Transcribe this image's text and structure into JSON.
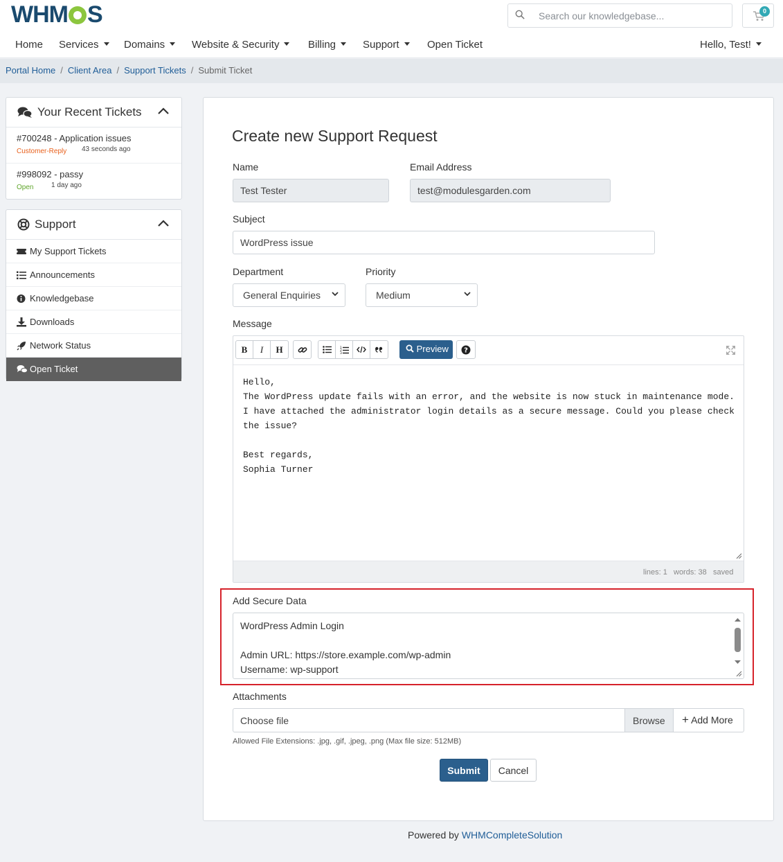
{
  "brand": {
    "logo_text_a": "WHM",
    "logo_text_b": "S",
    "colors": {
      "primary": "#2b5f8d",
      "accent": "#8cc63e",
      "highlight": "#d6222a"
    }
  },
  "search": {
    "placeholder": "Search our knowledgebase..."
  },
  "cart": {
    "count": "0"
  },
  "nav": {
    "home": "Home",
    "services": "Services",
    "domains": "Domains",
    "website_security": "Website & Security",
    "billing": "Billing",
    "support": "Support",
    "open_ticket": "Open Ticket",
    "user": "Hello, Test!"
  },
  "breadcrumb": {
    "portal_home": "Portal Home",
    "client_area": "Client Area",
    "support_tickets": "Support Tickets",
    "current": "Submit Ticket"
  },
  "recent_tickets": {
    "title": "Your Recent Tickets",
    "items": [
      {
        "title": "#700248 - Application issues",
        "status": "Customer-Reply",
        "status_color": "#e8601c",
        "ago": "43 seconds ago"
      },
      {
        "title": "#998092 - passy",
        "status": "Open",
        "status_color": "#5fa52a",
        "ago": "1 day ago"
      }
    ]
  },
  "support_panel": {
    "title": "Support",
    "items": [
      {
        "label": "My Support Tickets",
        "icon": "ticket-icon"
      },
      {
        "label": "Announcements",
        "icon": "list-icon"
      },
      {
        "label": "Knowledgebase",
        "icon": "info-icon"
      },
      {
        "label": "Downloads",
        "icon": "download-icon"
      },
      {
        "label": "Network Status",
        "icon": "rocket-icon"
      },
      {
        "label": "Open Ticket",
        "icon": "comments-icon"
      }
    ]
  },
  "form": {
    "title": "Create new Support Request",
    "name_label": "Name",
    "name_value": "Test Tester",
    "email_label": "Email Address",
    "email_value": "test@modulesgarden.com",
    "subject_label": "Subject",
    "subject_value": "WordPress issue",
    "department_label": "Department",
    "department_value": "General Enquiries",
    "priority_label": "Priority",
    "priority_value": "Medium",
    "message_label": "Message",
    "message_value": "Hello,\nThe WordPress update fails with an error, and the website is now stuck in maintenance mode.\nI have attached the administrator login details as a secure message. Could you please check\nthe issue?\n\nBest regards,\nSophia Turner",
    "preview_label": "Preview",
    "status_lines": "lines: 1",
    "status_words": "words: 38",
    "status_saved": "saved",
    "secure_label": "Add Secure Data",
    "secure_value": "WordPress Admin Login\n\nAdmin URL: https://store.example.com/wp-admin\nUsername: wp-support",
    "attachments_label": "Attachments",
    "choose_file": "Choose file",
    "browse": "Browse",
    "add_more": "Add More",
    "allowed": "Allowed File Extensions: .jpg, .gif, .jpeg, .png (Max file size: 512MB)",
    "submit": "Submit",
    "cancel": "Cancel"
  },
  "footer": {
    "powered_by": "Powered by",
    "link": "WHMCompleteSolution"
  }
}
